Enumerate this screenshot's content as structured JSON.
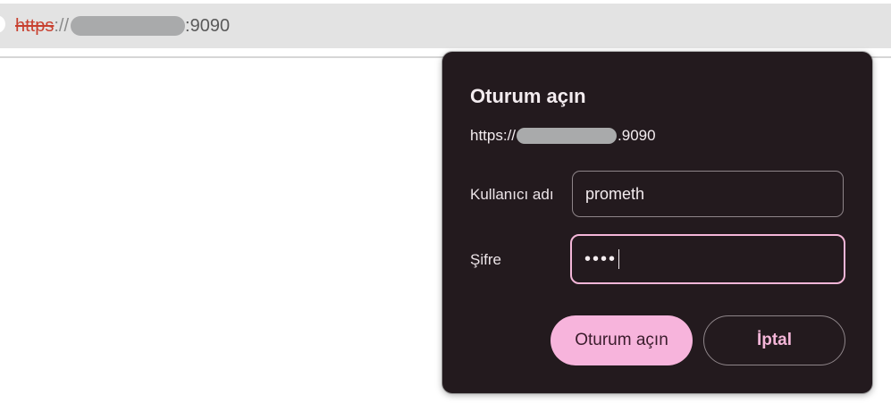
{
  "address_bar": {
    "scheme": "https",
    "separator": "://",
    "port": ":9090"
  },
  "dialog": {
    "title": "Oturum açın",
    "url_prefix": "https://",
    "url_suffix": ".9090",
    "username_label": "Kullanıcı adı",
    "username_value": "prometh",
    "password_label": "Şifre",
    "password_masked": "••••",
    "sign_in_label": "Oturum açın",
    "cancel_label": "İptal"
  },
  "colors": {
    "accent": "#f7b4dc",
    "dialog_bg": "#231a1e",
    "insecure_scheme": "#c8402f"
  }
}
